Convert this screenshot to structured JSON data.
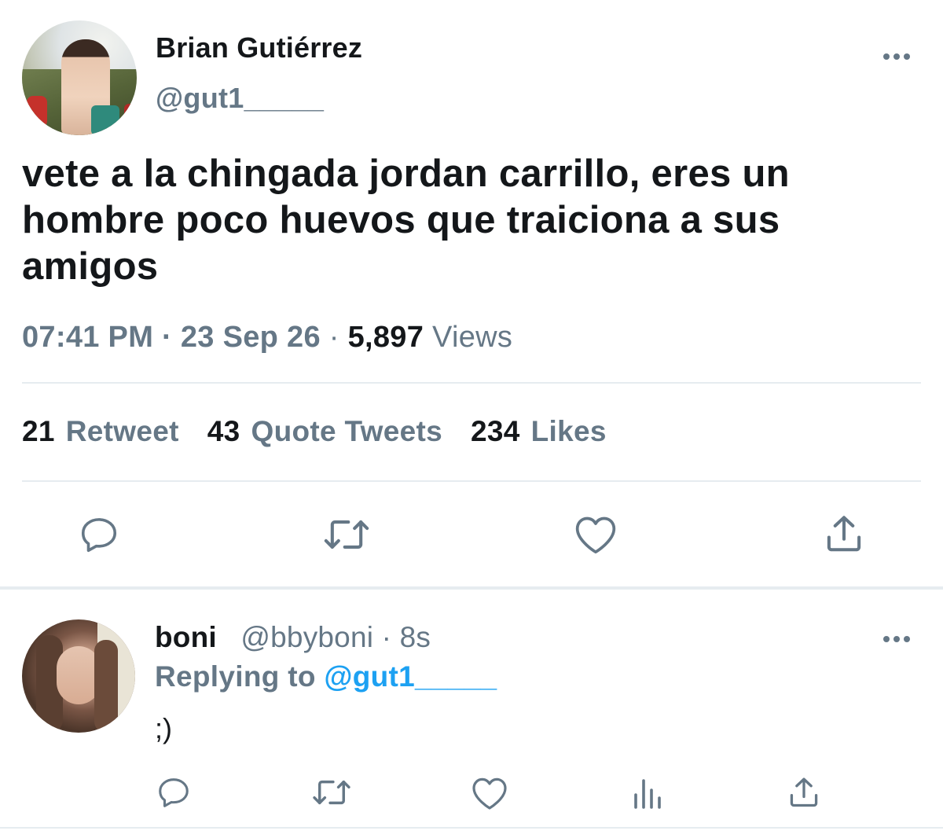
{
  "tweet": {
    "display_name": "Brian Gutiérrez",
    "handle": "@gut1_____",
    "text": "vete a la chingada jordan carrillo, eres un hombre poco huevos que traiciona a sus amigos",
    "time": "07:41 PM",
    "separator": "·",
    "date": "23 Sep 26",
    "views_count": "5,897",
    "views_label": "Views",
    "stats": {
      "retweets_count": "21",
      "retweets_label": "Retweet",
      "quotes_count": "43",
      "quotes_label": "Quote Tweets",
      "likes_count": "234",
      "likes_label": "Likes"
    },
    "actions": [
      "reply-icon",
      "retweet-icon",
      "like-icon",
      "share-icon"
    ]
  },
  "reply": {
    "display_name": "boni",
    "handle": "@bbyboni",
    "separator": "·",
    "time_ago": "8s",
    "replying_label": "Replying to",
    "replying_to": "@gut1_____",
    "text": ";)",
    "actions": [
      "reply-icon",
      "retweet-icon",
      "like-icon",
      "analytics-icon",
      "share-icon"
    ]
  },
  "colors": {
    "text_primary": "#14171a",
    "text_secondary": "#657786",
    "link": "#1da1f2",
    "divider": "#e6ecf0"
  }
}
